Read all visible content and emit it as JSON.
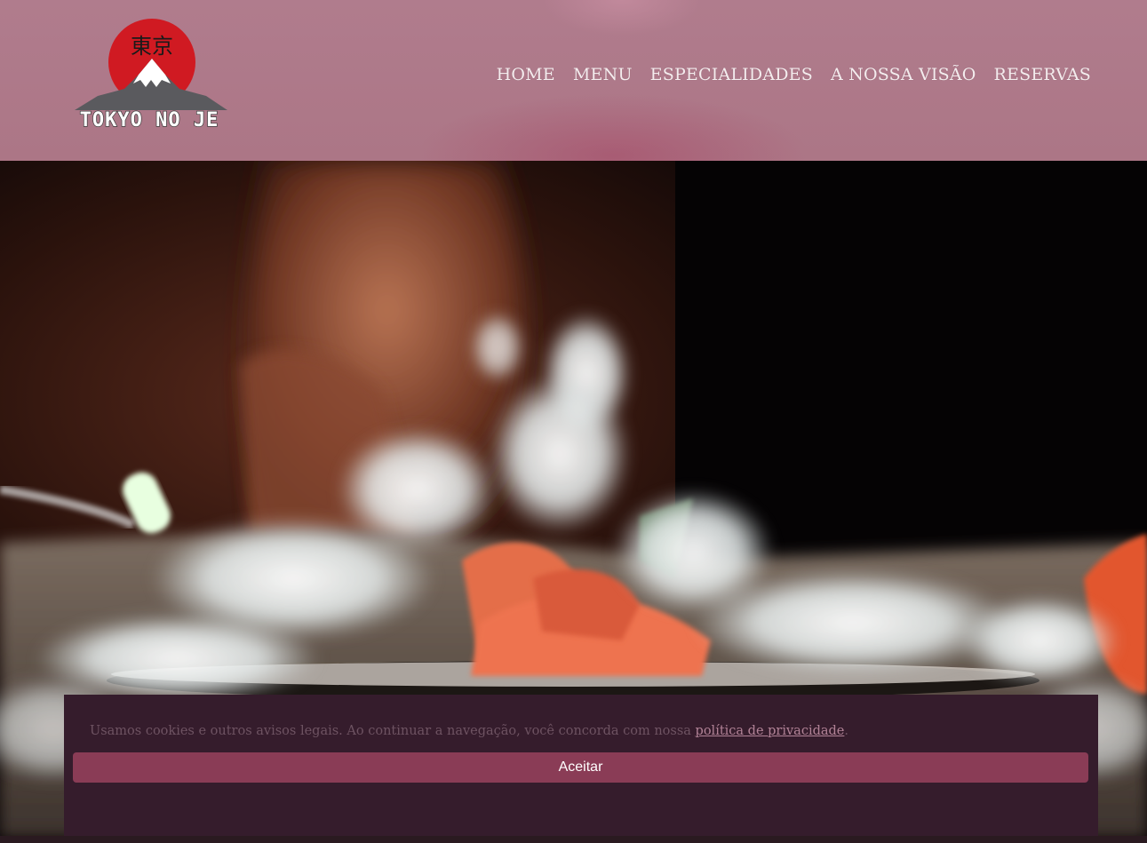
{
  "logo": {
    "kanji": "東京",
    "wordmark": "TOKYO NO JE",
    "icon": "mount-fuji-rising-sun-icon",
    "colors": {
      "sun": "#d01a22",
      "mountain": "#555555",
      "snow": "#ffffff"
    }
  },
  "nav": {
    "items": [
      {
        "label": "HOME"
      },
      {
        "label": "MENU"
      },
      {
        "label": "ESPECIALIDADES"
      },
      {
        "label": "A NOSSA VISÃO"
      },
      {
        "label": "RESERVAS"
      }
    ]
  },
  "hero": {
    "media": "hero-video-sashimi-dry-ice"
  },
  "cookie_banner": {
    "text": "Usamos cookies e outros avisos legais. Ao continuar a navegação, você concorda com nossa ",
    "link_label": "política de privacidade",
    "text_end": ".",
    "accept_label": "Aceitar"
  },
  "colors": {
    "header_bg": "#ad7888",
    "banner_bg": "#351c2c",
    "accent": "#8a3c56"
  }
}
